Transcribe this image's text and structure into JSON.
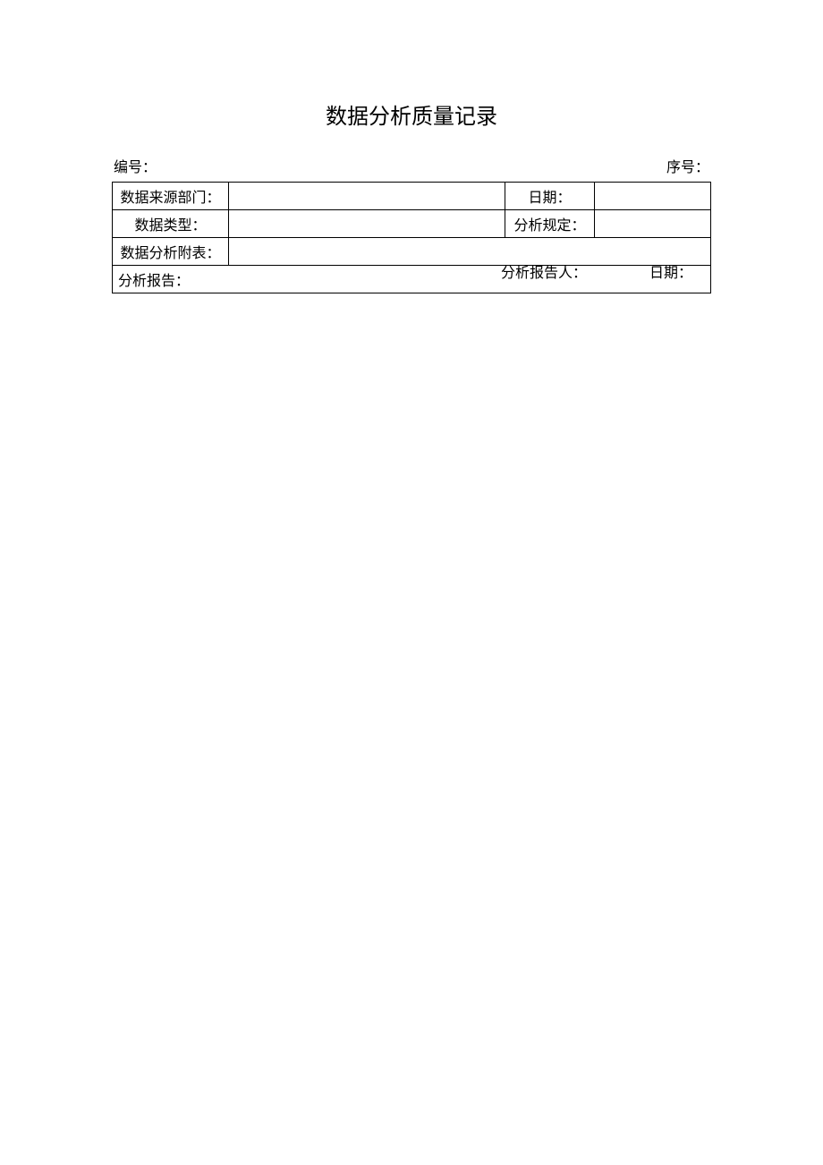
{
  "title": "数据分析质量记录",
  "meta": {
    "number_label": "编号：",
    "serial_label": "序号："
  },
  "form": {
    "source_dept_label": "数据来源部门：",
    "source_dept_value": "",
    "date_label": "日期：",
    "date_value": "",
    "data_type_label": "数据类型：",
    "data_type_value": "",
    "analysis_rule_label": "分析规定：",
    "analysis_rule_value": "",
    "attachment_label": "数据分析附表：",
    "attachment_value": "",
    "report_label": "分析报告：",
    "reporter_label": "分析报告人：",
    "report_date_label": "日期："
  }
}
